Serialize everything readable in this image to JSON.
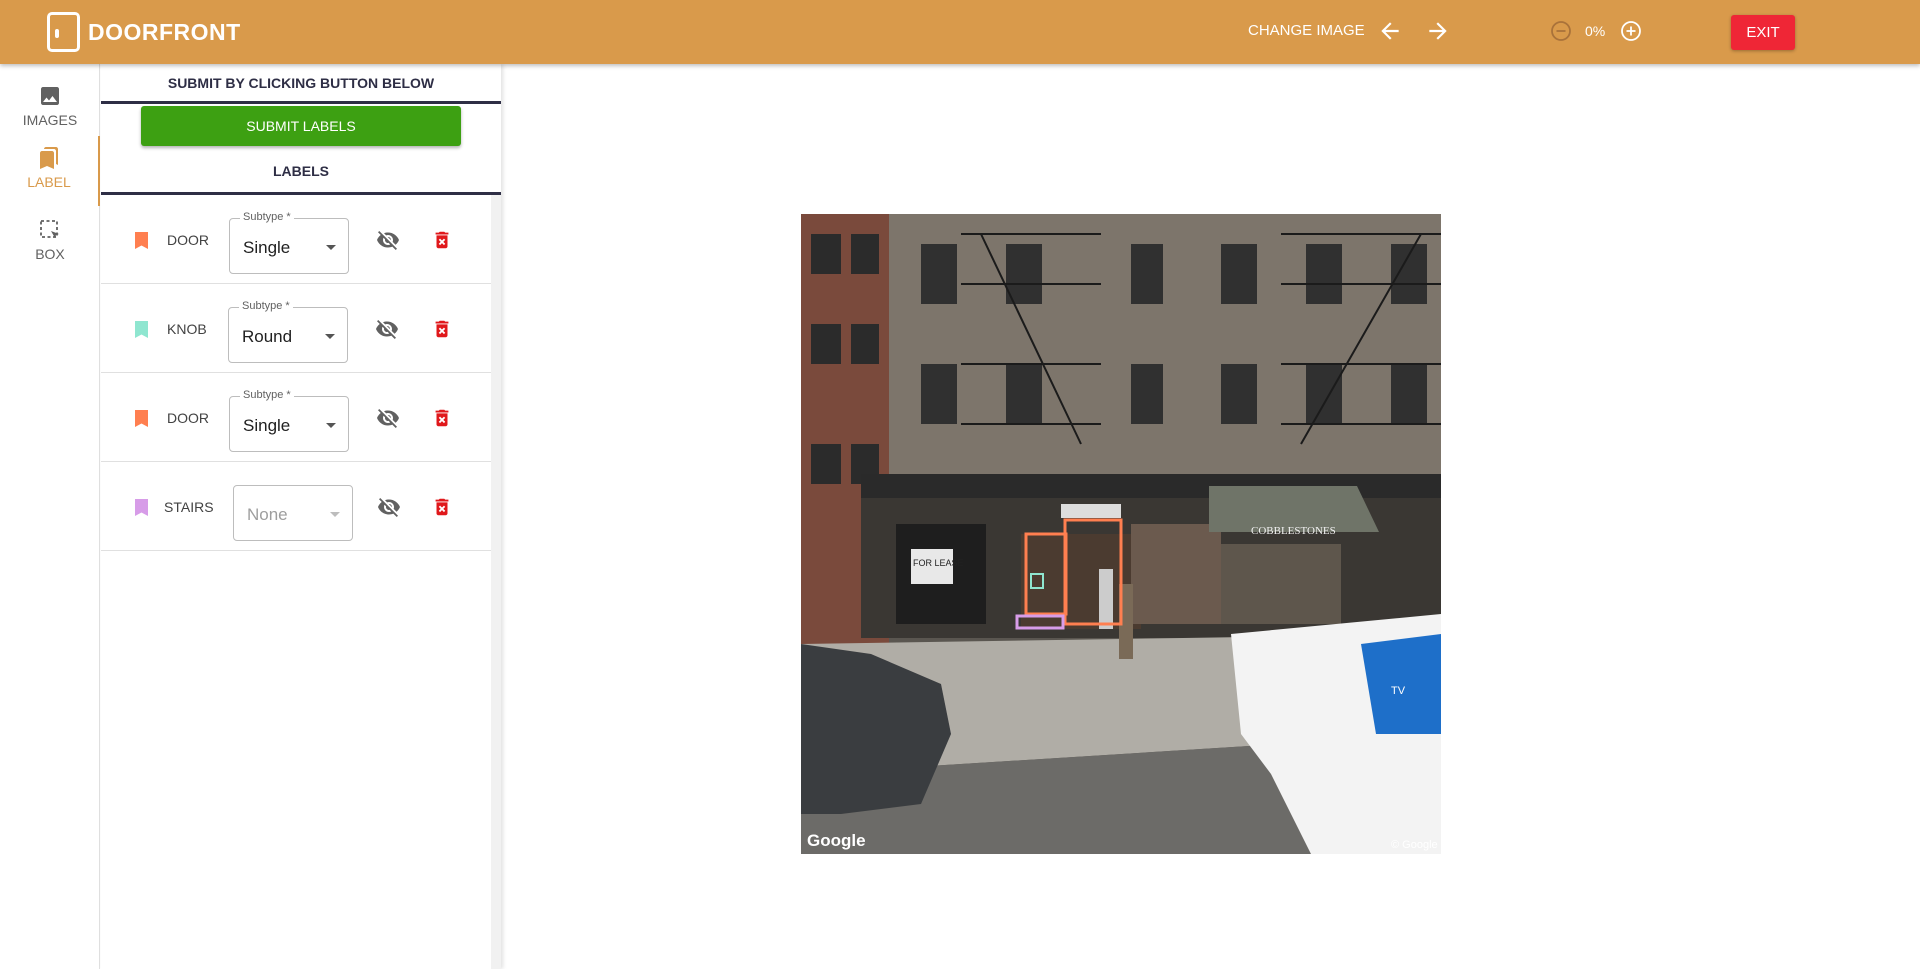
{
  "app": {
    "title": "DOORFRONT"
  },
  "toolbar": {
    "change_image_label": "CHANGE IMAGE",
    "zoom_value": "0%",
    "exit_label": "EXIT"
  },
  "leftnav": {
    "items": [
      {
        "label": "IMAGES",
        "icon": "image-icon"
      },
      {
        "label": "LABEL",
        "icon": "bookmarks-icon",
        "active": true
      },
      {
        "label": "BOX",
        "icon": "select-box-icon"
      }
    ]
  },
  "panel": {
    "submit_header": "SUBMIT BY CLICKING BUTTON BELOW",
    "submit_label": "SUBMIT LABELS",
    "labels_header": "LABELS",
    "subtype_legend": "Subtype *",
    "labels": [
      {
        "name": "DOOR",
        "subtype": "Single",
        "color": "#ff7f50"
      },
      {
        "name": "KNOB",
        "subtype": "Round",
        "color": "#8fe6d0"
      },
      {
        "name": "DOOR",
        "subtype": "Single",
        "color": "#ff7f50"
      },
      {
        "name": "STAIRS",
        "subtype": "None",
        "color": "#d79ce8"
      }
    ]
  },
  "photo": {
    "watermark_left": "Google",
    "watermark_right": "© Google",
    "sign_for_lease": "FOR LEASE",
    "sign_store": "COBBLESTONES",
    "van_text": "TV"
  },
  "colors": {
    "brand": "#d99a4b",
    "submit": "#3da012",
    "exit": "#ef2636",
    "delete": "#e0181b"
  }
}
